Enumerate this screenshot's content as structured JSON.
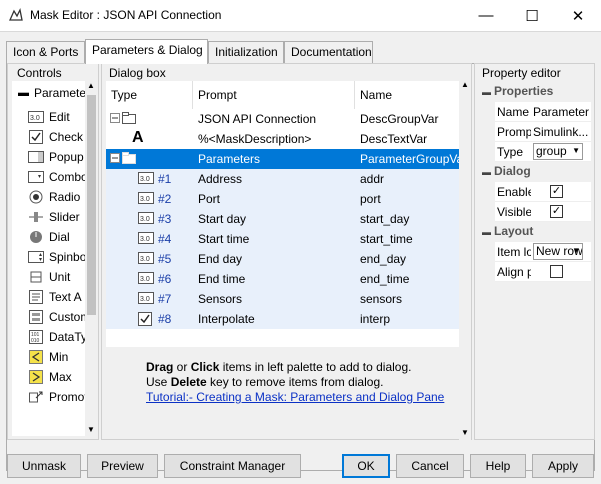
{
  "window": {
    "title": "Mask Editor : JSON API Connection",
    "minimize": "—",
    "maximize": "☐",
    "close": "✕"
  },
  "tabs": [
    "Icon & Ports",
    "Parameters & Dialog",
    "Initialization",
    "Documentation"
  ],
  "palette": {
    "header": "Controls",
    "tree_label": "Parameters",
    "items": [
      {
        "label": "Edit",
        "icon": "edit-icon"
      },
      {
        "label": "Check",
        "icon": "check-icon"
      },
      {
        "label": "Popup",
        "icon": "popup-icon"
      },
      {
        "label": "Combo",
        "icon": "combo-icon"
      },
      {
        "label": "Radio",
        "icon": "radio-icon"
      },
      {
        "label": "Slider",
        "icon": "slider-icon"
      },
      {
        "label": "Dial",
        "icon": "dial-icon"
      },
      {
        "label": "Spinbox",
        "icon": "spinbox-icon"
      },
      {
        "label": "Unit",
        "icon": "unit-icon"
      },
      {
        "label": "Text A",
        "icon": "text-area-icon"
      },
      {
        "label": "Custom",
        "icon": "custom-icon"
      },
      {
        "label": "DataType",
        "icon": "datatype-icon"
      },
      {
        "label": "Min",
        "icon": "min-icon"
      },
      {
        "label": "Max",
        "icon": "max-icon"
      },
      {
        "label": "Promote",
        "icon": "promote-icon"
      }
    ]
  },
  "dialog": {
    "header": "Dialog box",
    "columns": [
      "Type",
      "Prompt",
      "Name"
    ],
    "rows": [
      {
        "num": "",
        "prompt": "JSON API Connection",
        "name": "DescGroupVar",
        "kind": "group"
      },
      {
        "num": "",
        "prompt": "%<MaskDescription>",
        "name": "DescTextVar",
        "kind": "text"
      },
      {
        "num": "",
        "prompt": "Parameters",
        "name": "ParameterGroupVar",
        "kind": "group-active"
      },
      {
        "num": "#1",
        "prompt": "Address",
        "name": "addr",
        "kind": "edit"
      },
      {
        "num": "#2",
        "prompt": "Port",
        "name": "port",
        "kind": "edit"
      },
      {
        "num": "#3",
        "prompt": "Start day",
        "name": "start_day",
        "kind": "edit"
      },
      {
        "num": "#4",
        "prompt": "Start time",
        "name": "start_time",
        "kind": "edit"
      },
      {
        "num": "#5",
        "prompt": "End day",
        "name": "end_day",
        "kind": "edit"
      },
      {
        "num": "#6",
        "prompt": "End time",
        "name": "end_time",
        "kind": "edit"
      },
      {
        "num": "#7",
        "prompt": "Sensors",
        "name": "sensors",
        "kind": "edit"
      },
      {
        "num": "#8",
        "prompt": "Interpolate",
        "name": "interp",
        "kind": "check"
      }
    ],
    "help_line1_b1": "Drag",
    "help_line1_or": " or ",
    "help_line1_b2": "Click",
    "help_line1_rest": " items in left palette to add to dialog.",
    "help_line2_pre": "Use ",
    "help_line2_b": "Delete",
    "help_line2_rest": " key to remove items from dialog.",
    "help_link": "Tutorial:- Creating a Mask: Parameters and Dialog Pane"
  },
  "props": {
    "header": "Property editor",
    "sections": {
      "properties": "Properties",
      "dialog": "Dialog",
      "layout": "Layout"
    },
    "name_label": "Name",
    "name_value": "ParameterGroupVar",
    "prompt_label": "Prompt",
    "prompt_value": "Simulink...",
    "type_label": "Type",
    "type_value": "group",
    "enable_label": "Enable",
    "visible_label": "Visible",
    "itemloc_label": "Item location",
    "itemloc_value": "New row",
    "align_label": "Align prompts"
  },
  "buttons": {
    "unmask": "Unmask",
    "preview": "Preview",
    "constraint": "Constraint Manager",
    "ok": "OK",
    "cancel": "Cancel",
    "help": "Help",
    "apply": "Apply"
  }
}
